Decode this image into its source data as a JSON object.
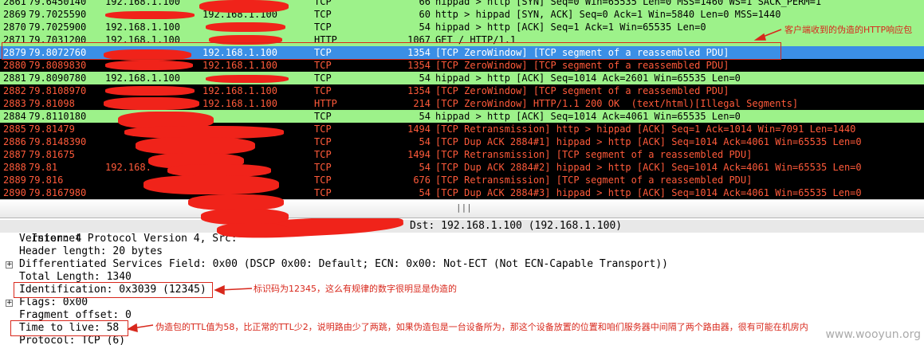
{
  "packets": [
    {
      "no": "2861",
      "time": "79.6450140",
      "src": "192.168.1.100",
      "dst": "",
      "proto": "TCP",
      "len": "66",
      "info": "hippad > http [SYN] Seq=0 Win=65535 Len=0 MSS=1460 WS=1 SACK_PERM=1",
      "style": "green"
    },
    {
      "no": "2869",
      "time": "79.7025590",
      "src": "",
      "dst": "192.168.1.100",
      "proto": "TCP",
      "len": "60",
      "info": "http > hippad [SYN, ACK] Seq=0 Ack=1 Win=5840 Len=0 MSS=1440",
      "style": "green"
    },
    {
      "no": "2870",
      "time": "79.7025900",
      "src": "192.168.1.100",
      "dst": "",
      "proto": "TCP",
      "len": "54",
      "info": "hippad > http [ACK] Seq=1 Ack=1 Win=65535 Len=0",
      "style": "green"
    },
    {
      "no": "2871",
      "time": "79.7031200",
      "src": "192.168.1.100",
      "dst": "",
      "proto": "HTTP",
      "len": "1067",
      "info": "GET / HTTP/1.1",
      "style": "green"
    },
    {
      "no": "2879",
      "time": "79.8072760",
      "src": "",
      "dst": "192.168.1.100",
      "proto": "TCP",
      "len": "1354",
      "info": "[TCP ZeroWindow] [TCP segment of a reassembled PDU]",
      "style": "selected"
    },
    {
      "no": "2880",
      "time": "79.8089830",
      "src": "",
      "dst": "192.168.1.100",
      "proto": "TCP",
      "len": "1354",
      "info": "[TCP ZeroWindow] [TCP segment of a reassembled PDU]",
      "style": "black"
    },
    {
      "no": "2881",
      "time": "79.8090780",
      "src": "192.168.1.100",
      "dst": "",
      "proto": "TCP",
      "len": "54",
      "info": "hippad > http [ACK] Seq=1014 Ack=2601 Win=65535 Len=0",
      "style": "green"
    },
    {
      "no": "2882",
      "time": "79.8108970",
      "src": "",
      "dst": "192.168.1.100",
      "proto": "TCP",
      "len": "1354",
      "info": "[TCP ZeroWindow] [TCP segment of a reassembled PDU]",
      "style": "black"
    },
    {
      "no": "2883",
      "time": "79.81098",
      "src": "",
      "dst": "192.168.1.100",
      "proto": "HTTP",
      "len": "214",
      "info": "[TCP ZeroWindow] HTTP/1.1 200 OK  (text/html)[Illegal Segments]",
      "style": "black"
    },
    {
      "no": "2884",
      "time": "79.8110180",
      "src": "",
      "dst": "",
      "proto": "TCP",
      "len": "54",
      "info": "hippad > http [ACK] Seq=1014 Ack=4061 Win=65535 Len=0",
      "style": "green"
    },
    {
      "no": "2885",
      "time": "79.81479",
      "src": "",
      "dst": "",
      "proto": "TCP",
      "len": "1494",
      "info": "[TCP Retransmission] http > hippad [ACK] Seq=1 Ack=1014 Win=7091 Len=1440",
      "style": "black"
    },
    {
      "no": "2886",
      "time": "79.8148390",
      "src": "",
      "dst": "",
      "proto": "TCP",
      "len": "54",
      "info": "[TCP Dup ACK 2884#1] hippad > http [ACK] Seq=1014 Ack=4061 Win=65535 Len=0",
      "style": "black"
    },
    {
      "no": "2887",
      "time": "79.81675",
      "src": "",
      "dst": "",
      "proto": "TCP",
      "len": "1494",
      "info": "[TCP Retransmission] [TCP segment of a reassembled PDU]",
      "style": "black"
    },
    {
      "no": "2888",
      "time": "79.81",
      "src": "192.168.",
      "dst": "",
      "proto": "TCP",
      "len": "54",
      "info": "[TCP Dup ACK 2884#2] hippad > http [ACK] Seq=1014 Ack=4061 Win=65535 Len=0",
      "style": "black"
    },
    {
      "no": "2889",
      "time": "79.816",
      "src": "",
      "dst": "",
      "proto": "TCP",
      "len": "676",
      "info": "[TCP Retransmission] [TCP segment of a reassembled PDU]",
      "style": "black"
    },
    {
      "no": "2890",
      "time": "79.8167980",
      "src": "",
      "dst": "",
      "proto": "TCP",
      "len": "54",
      "info": "[TCP Dup ACK 2884#3] hippad > http [ACK] Seq=1014 Ack=4061 Win=65535 Len=0",
      "style": "black"
    }
  ],
  "splitter_grip": "|||",
  "details": {
    "header_left": "Internet Protocol Version 4, Src: ",
    "header_right": "Dst: 192.168.1.100 (192.168.1.100)",
    "version": "Version: 4",
    "header_length": "Header length: 20 bytes",
    "dsfield": "Differentiated Services Field: 0x00 (DSCP 0x00: Default; ECN: 0x00: Not-ECT (Not ECN-Capable Transport))",
    "total_length": "Total Length: 1340",
    "identification": "Identification: 0x3039 (12345)",
    "flags": "Flags: 0x00",
    "fragment_offset": "Fragment offset: 0",
    "ttl": "Time to live: 58",
    "protocol": "Protocol: TCP (6)",
    "expander_glyph": "+"
  },
  "annotations": {
    "http_response": "客户端收到的伪造的HTTP响应包",
    "identification": "标识码为12345，这么有规律的数字很明显是伪造的",
    "ttl": "伪造包的TTL值为58，比正常的TTL少2，说明路由少了两跳，如果伪造包是一台设备所为，那这个设备放置的位置和咱们服务器中间隔了两个路由器，很有可能在机房内"
  },
  "watermark": "www.wooyun.org",
  "colors": {
    "row_green": "#9df28a",
    "row_black": "#000000",
    "row_black_text": "#ff5a3a",
    "row_selected": "#3b8fe6",
    "annotation_red": "#d8281c",
    "redaction": "#f0231a"
  }
}
